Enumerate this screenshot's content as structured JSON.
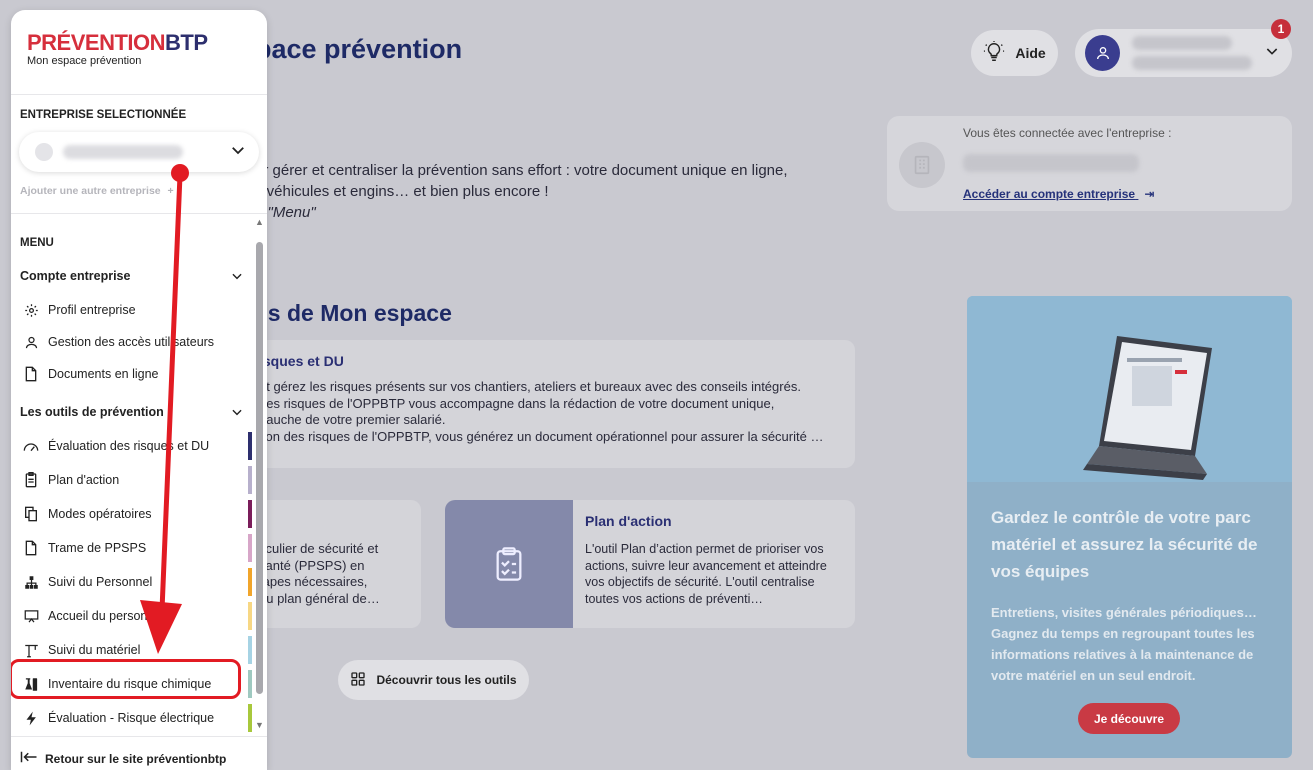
{
  "page": {
    "title": "pace prévention",
    "help_label": "Aide",
    "notification_count": "1",
    "intro_line1": "ur gérer et centraliser la prévention sans effort : votre document unique en ligne,",
    "intro_line2": "s véhicules et engins… et bien plus encore !",
    "intro_line3": "e \"Menu\"",
    "company_card": {
      "label": "Vous êtes connectée avec l'entreprise :",
      "link": "Accéder au compte entreprise"
    },
    "section_title": "és de Mon espace",
    "card_risks": {
      "title": "isques et DU",
      "desc1": "et gérez les risques présents sur vos chantiers, ateliers et bureaux avec des conseils intégrés.",
      "desc2": "des risques de l'OPPBTP vous accompagne dans la rédaction de votre document unique,",
      "desc3": "bauche de votre premier salarié.",
      "desc4": "tion des risques de l'OPPBTP, vous générez un document opérationnel pour assurer la sécurité …"
    },
    "card_left": {
      "desc1": "ticulier de sécurité et",
      "desc2": "santé (PPSPS) en",
      "desc3": "tapes nécessaires,",
      "desc4": "du plan général de…"
    },
    "card_plan": {
      "title": "Plan d'action",
      "desc": "L'outil Plan d’action permet de prioriser vos actions, suivre leur avancement et atteindre vos objectifs de sécurité. L'outil centralise toutes vos actions de préventi…"
    },
    "discover_label": "Découvrir tous les outils",
    "promo": {
      "heading": "Gardez le contrôle de votre parc matériel et assurez la sécurité de vos équipes",
      "text": "Entretiens, visites générales périodiques… Gagnez du temps en regroupant toutes les informations relatives à la maintenance de votre matériel en un seul endroit.",
      "button": "Je découvre"
    }
  },
  "sidebar": {
    "logo_red": "PRÉVENTION",
    "logo_blue": "BTP",
    "logo_sub": "Mon espace prévention",
    "selected_label": "ENTREPRISE SELECTIONNÉE",
    "add_company": "Ajouter une autre entreprise",
    "menu_label": "MENU",
    "group1": "Compte entreprise",
    "group1_items": [
      "Profil entreprise",
      "Gestion des accès utilisateurs",
      "Documents en ligne"
    ],
    "group2": "Les outils de prévention",
    "group2_items": [
      "Évaluation des risques et DU",
      "Plan d'action",
      "Modes opératoires",
      "Trame de PPSPS",
      "Suivi du Personnel",
      "Accueil du personnel",
      "Suivi du matériel",
      "Inventaire du risque chimique",
      "Évaluation - Risque électrique"
    ],
    "bar_colors": [
      "#2d2f6e",
      "#b7b0cc",
      "#7a1d5a",
      "#d7a6c8",
      "#f1a52b",
      "#f7d784",
      "#a6d3e4",
      "#9fc9c0",
      "#a8c83c"
    ],
    "back_label": "Retour sur le site préventionbtp"
  },
  "colors": {
    "brand_red": "#d62f3c",
    "brand_blue": "#2d2f6e",
    "annotation_red": "#e21b23"
  }
}
